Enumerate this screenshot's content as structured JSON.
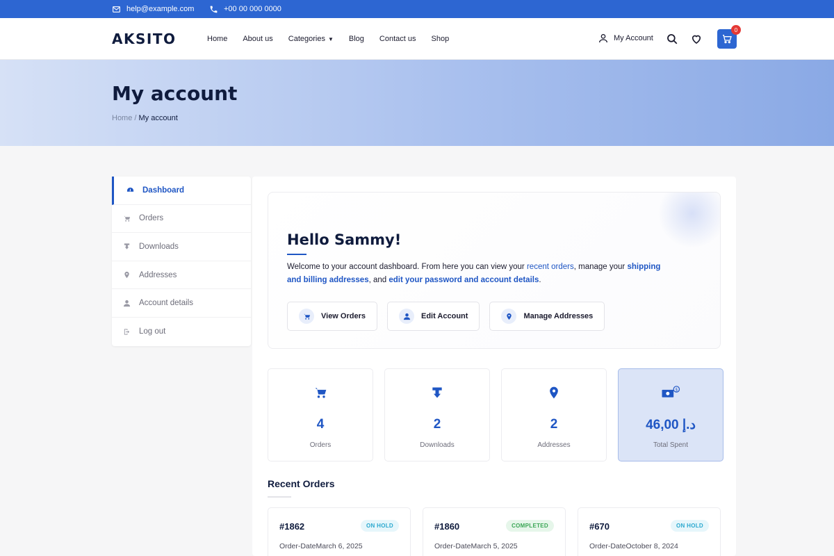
{
  "topbar": {
    "email": "help@example.com",
    "phone": "+00 00 000 0000"
  },
  "header": {
    "logo": "AKSITO",
    "nav": [
      {
        "label": "Home"
      },
      {
        "label": "About us"
      },
      {
        "label": "Categories"
      },
      {
        "label": "Blog"
      },
      {
        "label": "Contact us"
      },
      {
        "label": "Shop"
      }
    ],
    "account_label": "My Account",
    "cart_count": "0"
  },
  "hero": {
    "title": "My account",
    "crumb_home": "Home",
    "crumb_sep": " / ",
    "crumb_current": "My account"
  },
  "sidebar": {
    "items": [
      {
        "label": "Dashboard",
        "icon": "dashboard-icon"
      },
      {
        "label": "Orders",
        "icon": "cart-icon"
      },
      {
        "label": "Downloads",
        "icon": "download-icon"
      },
      {
        "label": "Addresses",
        "icon": "location-pin-icon"
      },
      {
        "label": "Account details",
        "icon": "user-icon"
      },
      {
        "label": "Log out",
        "icon": "logout-icon"
      }
    ]
  },
  "welcome": {
    "title": "Hello Sammy!",
    "intro_1": "Welcome to your account dashboard. From here you can view your ",
    "link_orders": "recent orders",
    "intro_2": ", manage your ",
    "link_addresses": "shipping and billing addresses",
    "intro_3": ", and ",
    "link_details": "edit your password and account details",
    "intro_4": ".",
    "buttons": [
      {
        "label": "View Orders",
        "icon": "cart-icon"
      },
      {
        "label": "Edit Account",
        "icon": "user-icon"
      },
      {
        "label": "Manage Addresses",
        "icon": "location-pin-icon"
      }
    ]
  },
  "stats": [
    {
      "value": "4",
      "label": "Orders",
      "icon": "cart-icon"
    },
    {
      "value": "2",
      "label": "Downloads",
      "icon": "download-icon"
    },
    {
      "value": "2",
      "label": "Addresses",
      "icon": "location-pin-icon"
    },
    {
      "value": "د.إ 46,00",
      "label": "Total Spent",
      "icon": "money-icon"
    }
  ],
  "recent": {
    "title": "Recent Orders",
    "orders": [
      {
        "number": "#1862",
        "status": "ON HOLD",
        "date": "Order-DateMarch 6, 2025"
      },
      {
        "number": "#1860",
        "status": "COMPLETED",
        "date": "Order-DateMarch 5, 2025"
      },
      {
        "number": "#670",
        "status": "ON HOLD",
        "date": "Order-DateOctober 8, 2024"
      }
    ]
  },
  "colors": {
    "accent": "#1f56c4",
    "topbar": "#2d66d2",
    "badge_cart": "#e53935"
  }
}
